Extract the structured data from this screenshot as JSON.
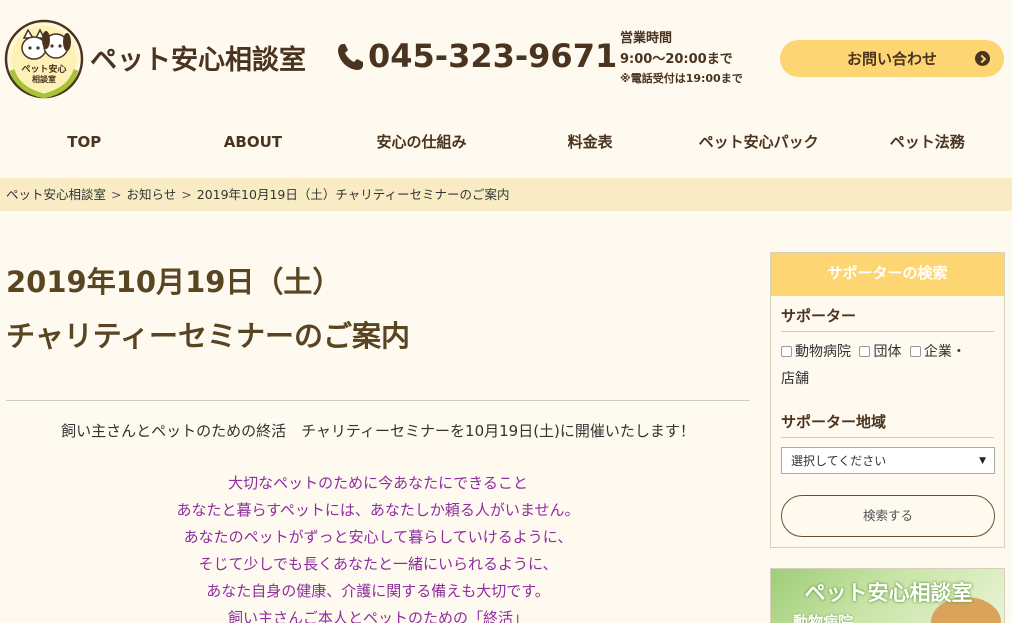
{
  "header": {
    "brand": "ペット安心相談室",
    "logo_text_line1": "ペット安心",
    "logo_text_line2": "相談室",
    "phone": "045-323-9671",
    "hours_label": "営業時間",
    "hours_time": "9:00〜20:00まで",
    "hours_note": "※電話受付は19:00まで",
    "contact_label": "お問い合わせ"
  },
  "nav": {
    "items": [
      "TOP",
      "ABOUT",
      "安心の仕組み",
      "料金表",
      "ペット安心パック",
      "ペット法務"
    ]
  },
  "breadcrumb": {
    "home": "ペット安心相談室",
    "section": "お知らせ",
    "current": "2019年10月19日（土）チャリティーセミナーのご案内",
    "separator": ">"
  },
  "post": {
    "title_line1": "2019年10月19日（土）",
    "title_line2": "チャリティーセミナーのご案内",
    "intro": "飼い主さんとペットのための終活　チャリティーセミナーを10月19日(土)に開催いたします！",
    "lines": [
      "大切なペットのために今あなたにできること",
      "あなたと暮らすペットには、あなたしか頼る人がいません。",
      "あなたのペットがずっと安心して暮らしていけるように、",
      "そじて少しでも長くあなたと一緒にいられるように、",
      "あなた自身の健康、介護に関する備えも大切です。",
      "飼い主さんご本人とペットのための「終活」"
    ]
  },
  "sidebar": {
    "heading": "サポーターの検索",
    "supporter_label": "サポーター",
    "options": [
      "動物病院",
      "団体",
      "企業・",
      "店舗"
    ],
    "region_label": "サポーター地域",
    "select_value": "選択してください",
    "search_label": "検索する",
    "banner_title": "ペット安心相談室",
    "banner_sub": "動物病院"
  },
  "colors": {
    "accent": "#fdd673",
    "brown": "#4a3420",
    "purple": "#8e2ea0",
    "breadcrumb_bg": "#f9ecc5"
  }
}
